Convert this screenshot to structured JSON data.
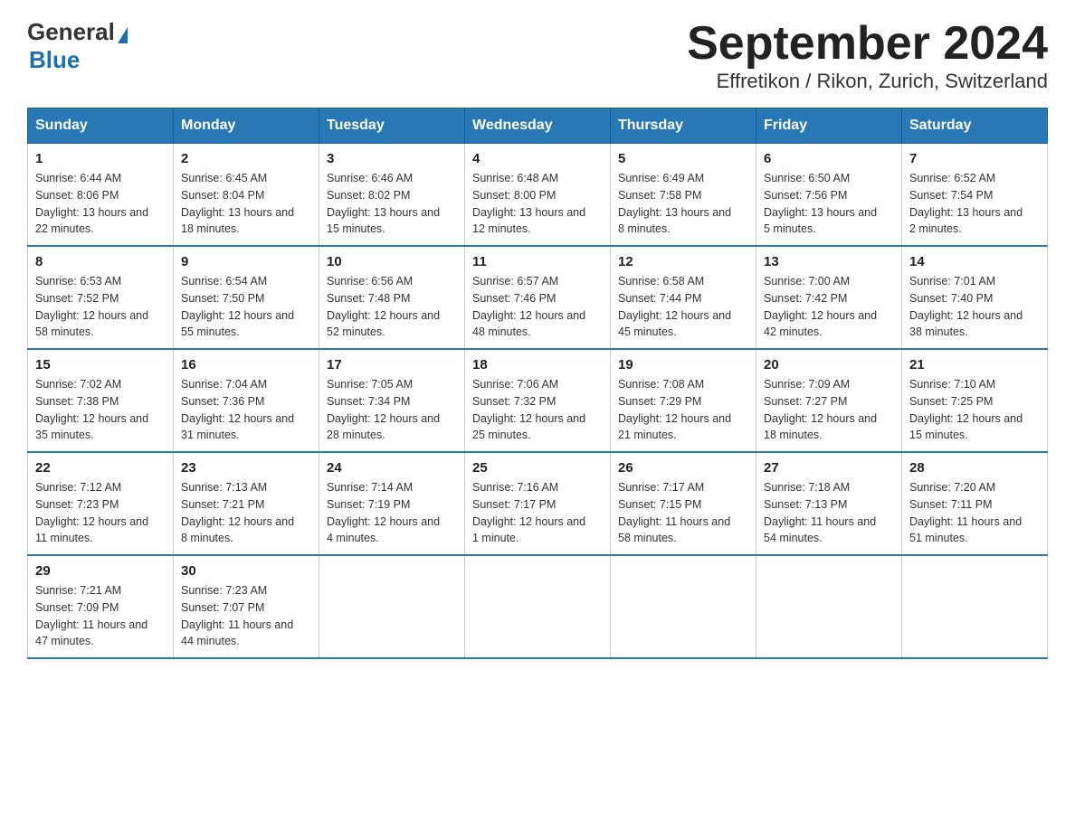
{
  "header": {
    "logo_general": "General",
    "logo_blue": "Blue",
    "title": "September 2024",
    "subtitle": "Effretikon / Rikon, Zurich, Switzerland"
  },
  "days_of_week": [
    "Sunday",
    "Monday",
    "Tuesday",
    "Wednesday",
    "Thursday",
    "Friday",
    "Saturday"
  ],
  "weeks": [
    [
      {
        "day": "1",
        "sunrise": "6:44 AM",
        "sunset": "8:06 PM",
        "daylight": "13 hours and 22 minutes."
      },
      {
        "day": "2",
        "sunrise": "6:45 AM",
        "sunset": "8:04 PM",
        "daylight": "13 hours and 18 minutes."
      },
      {
        "day": "3",
        "sunrise": "6:46 AM",
        "sunset": "8:02 PM",
        "daylight": "13 hours and 15 minutes."
      },
      {
        "day": "4",
        "sunrise": "6:48 AM",
        "sunset": "8:00 PM",
        "daylight": "13 hours and 12 minutes."
      },
      {
        "day": "5",
        "sunrise": "6:49 AM",
        "sunset": "7:58 PM",
        "daylight": "13 hours and 8 minutes."
      },
      {
        "day": "6",
        "sunrise": "6:50 AM",
        "sunset": "7:56 PM",
        "daylight": "13 hours and 5 minutes."
      },
      {
        "day": "7",
        "sunrise": "6:52 AM",
        "sunset": "7:54 PM",
        "daylight": "13 hours and 2 minutes."
      }
    ],
    [
      {
        "day": "8",
        "sunrise": "6:53 AM",
        "sunset": "7:52 PM",
        "daylight": "12 hours and 58 minutes."
      },
      {
        "day": "9",
        "sunrise": "6:54 AM",
        "sunset": "7:50 PM",
        "daylight": "12 hours and 55 minutes."
      },
      {
        "day": "10",
        "sunrise": "6:56 AM",
        "sunset": "7:48 PM",
        "daylight": "12 hours and 52 minutes."
      },
      {
        "day": "11",
        "sunrise": "6:57 AM",
        "sunset": "7:46 PM",
        "daylight": "12 hours and 48 minutes."
      },
      {
        "day": "12",
        "sunrise": "6:58 AM",
        "sunset": "7:44 PM",
        "daylight": "12 hours and 45 minutes."
      },
      {
        "day": "13",
        "sunrise": "7:00 AM",
        "sunset": "7:42 PM",
        "daylight": "12 hours and 42 minutes."
      },
      {
        "day": "14",
        "sunrise": "7:01 AM",
        "sunset": "7:40 PM",
        "daylight": "12 hours and 38 minutes."
      }
    ],
    [
      {
        "day": "15",
        "sunrise": "7:02 AM",
        "sunset": "7:38 PM",
        "daylight": "12 hours and 35 minutes."
      },
      {
        "day": "16",
        "sunrise": "7:04 AM",
        "sunset": "7:36 PM",
        "daylight": "12 hours and 31 minutes."
      },
      {
        "day": "17",
        "sunrise": "7:05 AM",
        "sunset": "7:34 PM",
        "daylight": "12 hours and 28 minutes."
      },
      {
        "day": "18",
        "sunrise": "7:06 AM",
        "sunset": "7:32 PM",
        "daylight": "12 hours and 25 minutes."
      },
      {
        "day": "19",
        "sunrise": "7:08 AM",
        "sunset": "7:29 PM",
        "daylight": "12 hours and 21 minutes."
      },
      {
        "day": "20",
        "sunrise": "7:09 AM",
        "sunset": "7:27 PM",
        "daylight": "12 hours and 18 minutes."
      },
      {
        "day": "21",
        "sunrise": "7:10 AM",
        "sunset": "7:25 PM",
        "daylight": "12 hours and 15 minutes."
      }
    ],
    [
      {
        "day": "22",
        "sunrise": "7:12 AM",
        "sunset": "7:23 PM",
        "daylight": "12 hours and 11 minutes."
      },
      {
        "day": "23",
        "sunrise": "7:13 AM",
        "sunset": "7:21 PM",
        "daylight": "12 hours and 8 minutes."
      },
      {
        "day": "24",
        "sunrise": "7:14 AM",
        "sunset": "7:19 PM",
        "daylight": "12 hours and 4 minutes."
      },
      {
        "day": "25",
        "sunrise": "7:16 AM",
        "sunset": "7:17 PM",
        "daylight": "12 hours and 1 minute."
      },
      {
        "day": "26",
        "sunrise": "7:17 AM",
        "sunset": "7:15 PM",
        "daylight": "11 hours and 58 minutes."
      },
      {
        "day": "27",
        "sunrise": "7:18 AM",
        "sunset": "7:13 PM",
        "daylight": "11 hours and 54 minutes."
      },
      {
        "day": "28",
        "sunrise": "7:20 AM",
        "sunset": "7:11 PM",
        "daylight": "11 hours and 51 minutes."
      }
    ],
    [
      {
        "day": "29",
        "sunrise": "7:21 AM",
        "sunset": "7:09 PM",
        "daylight": "11 hours and 47 minutes."
      },
      {
        "day": "30",
        "sunrise": "7:23 AM",
        "sunset": "7:07 PM",
        "daylight": "11 hours and 44 minutes."
      },
      null,
      null,
      null,
      null,
      null
    ]
  ],
  "labels": {
    "sunrise": "Sunrise:",
    "sunset": "Sunset:",
    "daylight": "Daylight:"
  }
}
